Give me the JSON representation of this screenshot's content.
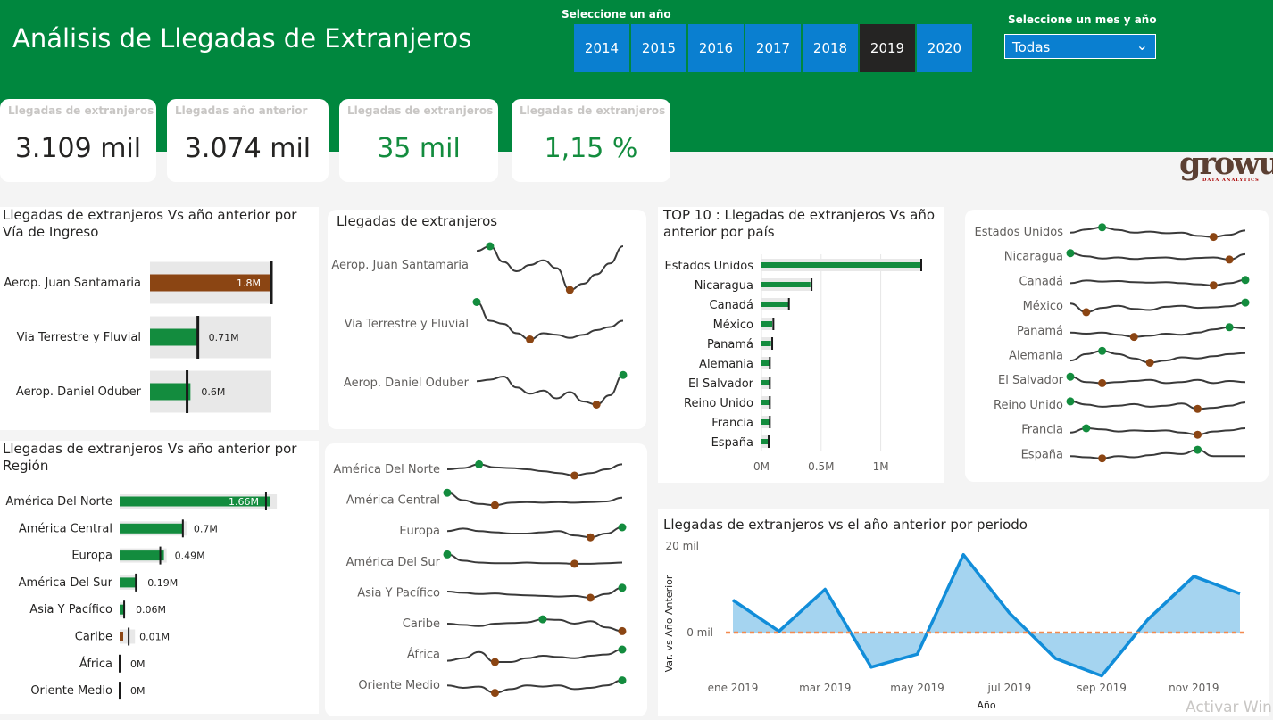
{
  "header": {
    "title": "Análisis de Llegadas de Extranjeros",
    "year_label": "Seleccione un año",
    "years": [
      "2014",
      "2015",
      "2016",
      "2017",
      "2018",
      "2019",
      "2020"
    ],
    "selected_year": "2019",
    "month_label": "Seleccione un mes y año",
    "month_value": "Todas"
  },
  "kpis": [
    {
      "label": "Llegadas de extranjeros",
      "value": "3.109 mil"
    },
    {
      "label": "Llegadas año anterior",
      "value": "3.074 mil"
    },
    {
      "label": "Llegadas de extranjeros",
      "value": "35 mil"
    },
    {
      "label": "Llegadas de extranjeros",
      "value": "1,15 %"
    }
  ],
  "logo": {
    "text": "growup",
    "sub": "DATA ANALYTICS"
  },
  "watermark": "Activar Win",
  "colors": {
    "header_green": "#00873e",
    "year_blue": "#0a7fd0",
    "bar_green": "#138c3e",
    "bar_brown": "#8b4513",
    "area_blue": "#9bcfee",
    "line_blue": "#118dd9",
    "target_orange": "#f28a50"
  },
  "chart_data": [
    {
      "type": "bar",
      "title": "Llegadas de extranjeros Vs año anterior por Vía de Ingreso",
      "categories": [
        "Aerop. Juan Santamaria",
        "Via Terrestre y Fluvial",
        "Aerop. Daniel Oduber"
      ],
      "values": [
        1.8,
        0.71,
        0.6
      ],
      "targets": [
        1.8,
        0.71,
        0.55
      ],
      "labels": [
        "1.8M",
        "0.71M",
        "0.6M"
      ],
      "bar_colors": [
        "#8b4513",
        "#138c3e",
        "#138c3e"
      ],
      "unit": "M",
      "xmax": 1.9
    },
    {
      "type": "bar",
      "title": "Llegadas de extranjeros Vs año anterior por Región",
      "categories": [
        "América Del Norte",
        "América Central",
        "Europa",
        "América Del Sur",
        "Asia Y Pacífico",
        "Caribe",
        "África",
        "Oriente Medio"
      ],
      "values": [
        1.66,
        0.7,
        0.49,
        0.19,
        0.06,
        0.01,
        0,
        0
      ],
      "targets": [
        1.62,
        0.7,
        0.45,
        0.18,
        0.05,
        0.1,
        0,
        0
      ],
      "labels": [
        "1.66M",
        "0.7M",
        "0.49M",
        "0.19M",
        "0.06M",
        "0.01M",
        "0M",
        "0M"
      ],
      "bar_colors": [
        "#138c3e",
        "#138c3e",
        "#138c3e",
        "#138c3e",
        "#138c3e",
        "#8b4513",
        "#138c3e",
        "#138c3e"
      ],
      "unit": "M",
      "xmax": 1.66
    },
    {
      "type": "line",
      "title": "Llegadas de extranjeros",
      "series": [
        {
          "name": "Aerop. Juan Santamaria",
          "values": [
            0.45,
            0.6,
            0.1,
            -0.2,
            0.0,
            0.15,
            -0.1,
            -0.8,
            -0.6,
            -0.3,
            0.05,
            0.6
          ]
        },
        {
          "name": "Via Terrestre y Fluvial",
          "values": [
            0.7,
            0.1,
            0.0,
            -0.3,
            -0.5,
            -0.3,
            -0.35,
            -0.45,
            -0.35,
            -0.2,
            -0.1,
            0.1
          ]
        },
        {
          "name": "Aerop. Daniel Oduber",
          "values": [
            0.05,
            0.1,
            0.2,
            -0.15,
            -0.35,
            -0.25,
            -0.5,
            -0.3,
            -0.6,
            -0.7,
            -0.4,
            0.25
          ]
        }
      ]
    },
    {
      "type": "bar",
      "title": "TOP 10 : Llegadas de extranjeros Vs año anterior por país",
      "categories": [
        "Estados Unidos",
        "Nicaragua",
        "Canadá",
        "México",
        "Panamá",
        "Alemania",
        "El Salvador",
        "Reino Unido",
        "Francia",
        "España"
      ],
      "values": [
        1.34,
        0.41,
        0.23,
        0.09,
        0.08,
        0.07,
        0.07,
        0.07,
        0.07,
        0.06
      ],
      "targets": [
        1.34,
        0.42,
        0.23,
        0.1,
        0.09,
        0.07,
        0.07,
        0.07,
        0.07,
        0.06
      ],
      "xticks": [
        "0M",
        "0.5M",
        "1M"
      ],
      "xtick_values": [
        0,
        0.5,
        1.0
      ],
      "xmax": 1.4
    },
    {
      "type": "line",
      "title": "",
      "series": [
        {
          "name": "Estados Unidos",
          "values": [
            0.1,
            0.4,
            0.6,
            0.35,
            0.1,
            0.2,
            0.05,
            0.1,
            -0.2,
            -0.3,
            -0.1,
            0.3
          ]
        },
        {
          "name": "Nicaragua",
          "values": [
            0.5,
            0.2,
            0.0,
            0.1,
            -0.05,
            0.05,
            0.1,
            -0.05,
            0.05,
            0.1,
            -0.1,
            0.4
          ]
        },
        {
          "name": "Canadá",
          "values": [
            0.0,
            0.25,
            0.15,
            0.2,
            0.1,
            0.05,
            0.1,
            0.0,
            -0.1,
            -0.2,
            0.0,
            0.3
          ]
        },
        {
          "name": "México",
          "values": [
            0.4,
            -0.4,
            0.0,
            0.2,
            -0.1,
            -0.2,
            0.1,
            0.2,
            0.0,
            0.05,
            0.15,
            0.5
          ]
        },
        {
          "name": "Panamá",
          "values": [
            0.0,
            -0.1,
            0.0,
            -0.2,
            -0.4,
            -0.3,
            -0.1,
            -0.2,
            0.0,
            0.3,
            0.5,
            0.4
          ]
        },
        {
          "name": "Alemania",
          "values": [
            -0.3,
            0.3,
            0.6,
            0.3,
            -0.1,
            -0.5,
            -0.3,
            0.0,
            -0.1,
            0.1,
            0.3,
            0.4
          ]
        },
        {
          "name": "El Salvador",
          "values": [
            0.5,
            0.0,
            -0.1,
            0.0,
            0.1,
            0.2,
            -0.1,
            0.0,
            0.2,
            -0.1,
            0.1,
            0.0
          ]
        },
        {
          "name": "Reino Unido",
          "values": [
            0.5,
            0.2,
            0.0,
            0.1,
            0.25,
            0.0,
            0.1,
            0.3,
            -0.2,
            -0.1,
            0.1,
            0.4
          ]
        },
        {
          "name": "Francia",
          "values": [
            -0.1,
            0.3,
            0.2,
            0.0,
            0.1,
            0.05,
            0.1,
            -0.1,
            -0.3,
            0.0,
            0.1,
            0.3
          ]
        },
        {
          "name": "España",
          "values": [
            0.0,
            -0.1,
            -0.2,
            0.0,
            -0.1,
            0.1,
            0.3,
            0.2,
            0.6,
            0.0,
            0.0,
            0.0
          ]
        }
      ]
    },
    {
      "type": "bar",
      "title": "",
      "categories": [
        "América Del Norte",
        "América Central",
        "Europa",
        "América Del Sur",
        "Asia Y Pacífico",
        "Caribe",
        "África",
        "Oriente Medio"
      ],
      "values": []
    },
    {
      "type": "line",
      "title": "",
      "series": [
        {
          "name": "América Del Norte",
          "values": [
            0.0,
            0.1,
            0.4,
            0.15,
            0.1,
            0.0,
            -0.15,
            -0.3,
            -0.5,
            -0.3,
            0.0,
            0.4
          ]
        },
        {
          "name": "América Central",
          "values": [
            0.6,
            0.0,
            -0.3,
            -0.4,
            -0.2,
            -0.15,
            -0.2,
            -0.15,
            -0.2,
            -0.15,
            -0.1,
            0.2
          ]
        },
        {
          "name": "Europa",
          "values": [
            0.0,
            0.2,
            0.0,
            -0.1,
            -0.2,
            -0.2,
            -0.1,
            0.0,
            -0.35,
            -0.5,
            -0.2,
            0.3
          ]
        },
        {
          "name": "América Del Sur",
          "values": [
            0.6,
            0.1,
            -0.05,
            -0.1,
            -0.1,
            -0.05,
            -0.1,
            -0.1,
            -0.15,
            -0.15,
            -0.1,
            -0.05
          ]
        },
        {
          "name": "Asia Y Pacífico",
          "values": [
            0.1,
            0.0,
            -0.1,
            -0.05,
            -0.15,
            -0.2,
            -0.25,
            -0.3,
            -0.25,
            -0.4,
            -0.1,
            0.4
          ]
        },
        {
          "name": "Caribe",
          "values": [
            0.0,
            -0.1,
            -0.2,
            0.0,
            0.05,
            0.1,
            0.35,
            0.3,
            0.0,
            0.2,
            -0.3,
            -0.6
          ]
        },
        {
          "name": "África",
          "values": [
            -0.5,
            -0.3,
            0.2,
            -0.6,
            -0.6,
            -0.3,
            -0.1,
            -0.2,
            -0.3,
            -0.1,
            0.0,
            0.4
          ]
        },
        {
          "name": "Oriente Medio",
          "values": [
            0.0,
            -0.2,
            -0.1,
            -0.6,
            -0.3,
            0.0,
            -0.1,
            0.0,
            -0.3,
            -0.2,
            0.0,
            0.4
          ]
        }
      ]
    },
    {
      "type": "area",
      "title": "Llegadas de extranjeros vs el año anterior por periodo",
      "xlabel": "Año",
      "ylabel": "Var. vs Año Anterior",
      "x": [
        "ene 2019",
        "feb 2019",
        "mar 2019",
        "abr 2019",
        "may 2019",
        "jun 2019",
        "jul 2019",
        "ago 2019",
        "sep 2019",
        "oct 2019",
        "nov 2019",
        "dic 2019"
      ],
      "xticks": [
        "ene 2019",
        "mar 2019",
        "may 2019",
        "jul 2019",
        "sep 2019",
        "nov 2019"
      ],
      "values": [
        7.5,
        0.3,
        10,
        -8,
        -5,
        18,
        4.5,
        -6,
        -10,
        3,
        13,
        9
      ],
      "yticks": [
        "20 mil",
        "0 mil"
      ],
      "ytick_values": [
        20,
        0
      ],
      "ylim": [
        -10,
        20
      ],
      "unit": "mil",
      "reference_line": 0
    }
  ]
}
